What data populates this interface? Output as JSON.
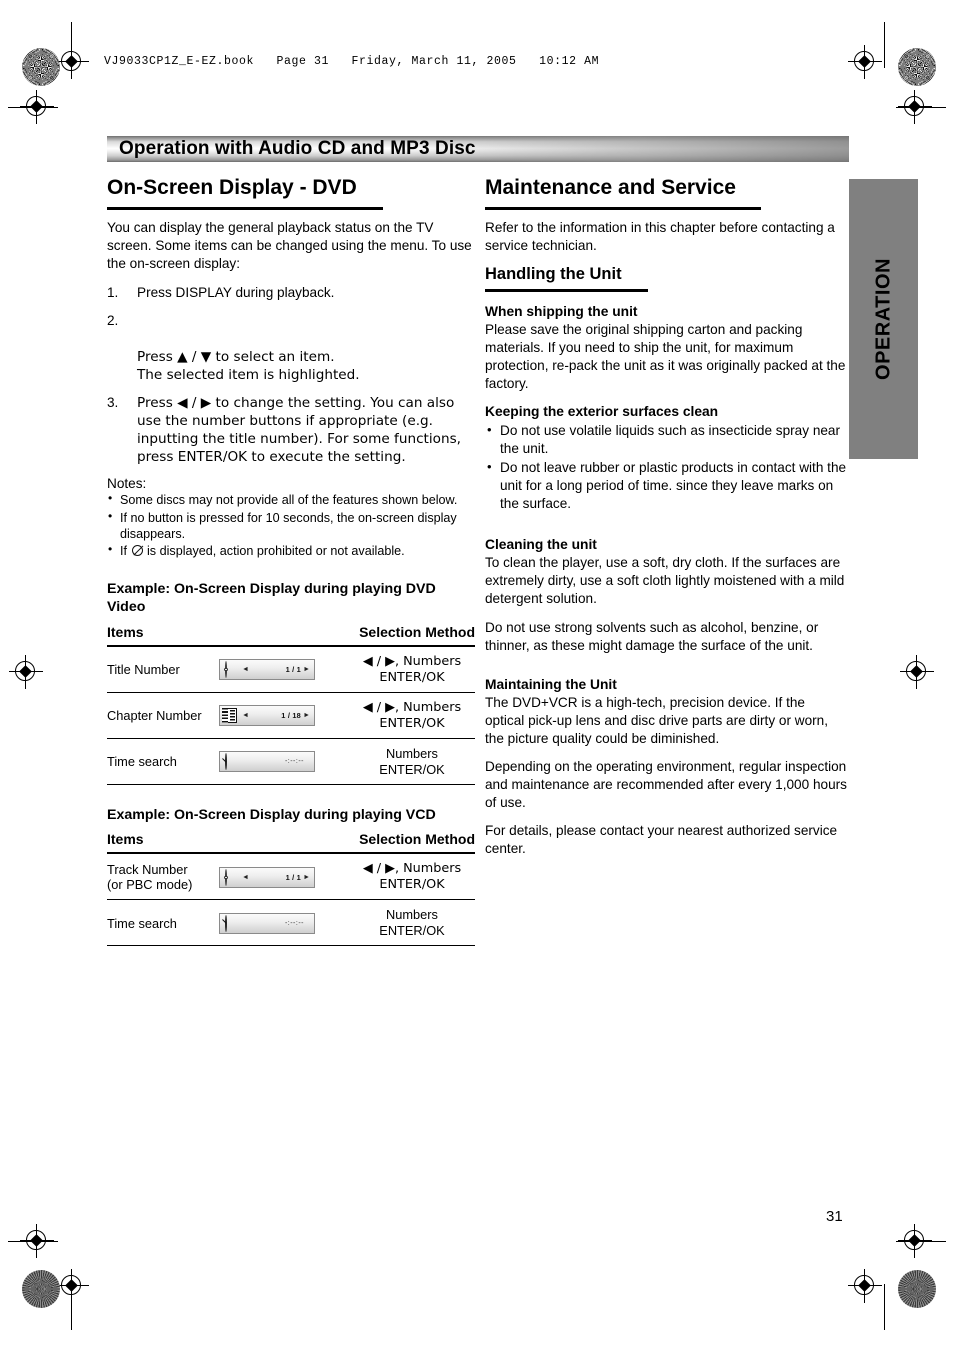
{
  "file_header": "VJ9033CP1Z_E-EZ.book   Page 31   Friday, March 11, 2005   10:12 AM",
  "chapter_bar": {
    "title": "Operation with Audio CD and MP3 Disc"
  },
  "side_tab": {
    "label": "OPERATION"
  },
  "page_number": "31",
  "left_column": {
    "heading": "On-Screen Display - DVD",
    "intro": "You can display the general playback status on the TV screen. Some items can be changed using the menu. To use the on-screen display:",
    "steps": [
      {
        "num": "1.",
        "text": "Press DISPLAY during playback."
      },
      {
        "num": "2.",
        "text": "Press ▲ / ▼ to select an item.\nThe selected item is highlighted."
      },
      {
        "num": "3.",
        "text": "Press ◀ / ▶ to change the setting. You can also use the number buttons if appropriate (e.g. inputting the title number). For some functions, press ENTER/OK to execute the setting."
      }
    ],
    "notes_title": "Notes:",
    "notes": [
      "Some discs may not provide all of the features shown below.",
      "If no button is pressed for 10 seconds, the on-screen display disappears.",
      "If   is displayed, action prohibited or not available."
    ],
    "note3_pre": "If",
    "note3_post": "is displayed, action prohibited or not available.",
    "example1_title": "Example: On-Screen Display during playing DVD Video",
    "table1": {
      "headers": {
        "items": "Items",
        "method": "Selection Method"
      },
      "rows": [
        {
          "item": "Title Number",
          "icon": "disc-icon",
          "osd_value": "1 / 1",
          "arrow_left": "◄",
          "arrow_right": "►",
          "method_line1": "◀ / ▶, Numbers",
          "method_line2": "ENTER/OK"
        },
        {
          "item": "Chapter Number",
          "icon": "film-icon",
          "osd_value": "1 / 18",
          "arrow_left": "◄",
          "arrow_right": "►",
          "method_line1": "◀ / ▶, Numbers",
          "method_line2": "ENTER/OK"
        },
        {
          "item": "Time search",
          "icon": "clock-icon",
          "osd_value": "-:--:--",
          "arrow_left": "",
          "arrow_right": "",
          "method_line1": "Numbers",
          "method_line2": "ENTER/OK"
        }
      ]
    },
    "example2_title": "Example: On-Screen Display during playing VCD",
    "table2": {
      "headers": {
        "items": "Items",
        "method": "Selection Method"
      },
      "rows": [
        {
          "item": "Track Number\n(or PBC mode)",
          "icon": "disc-icon",
          "osd_value": "1 / 1",
          "arrow_left": "◄",
          "arrow_right": "►",
          "method_line1": "◀ / ▶, Numbers",
          "method_line2": "ENTER/OK"
        },
        {
          "item": "Time search",
          "icon": "clock-icon",
          "osd_value": "-:--:--",
          "arrow_left": "",
          "arrow_right": "",
          "method_line1": "Numbers",
          "method_line2": "ENTER/OK"
        }
      ]
    }
  },
  "right_column": {
    "heading": "Maintenance and Service",
    "intro": "Refer to the information in this chapter before contacting a service technician.",
    "subsection": "Handling the Unit",
    "blocks": [
      {
        "subhead": "When shipping the unit",
        "paragraph": "Please save the original shipping carton and packing materials. If you need to ship the unit, for maximum protection, re-pack the unit as it was originally packed at the factory."
      },
      {
        "subhead": "Keeping the exterior surfaces clean",
        "bullets": [
          "Do not use volatile liquids such as insecticide spray near the unit.",
          "Do not leave rubber or plastic products in contact with the unit for a long period of time. since they leave marks on the surface."
        ]
      },
      {
        "subhead": "Cleaning the unit",
        "paragraph": "To clean the player, use a soft, dry cloth. If the surfaces are extremely dirty, use a soft cloth lightly moistened with a mild detergent solution.",
        "paragraph2": "Do not use strong solvents such as alcohol, benzine, or thinner, as these might damage the surface of the unit."
      },
      {
        "subhead": "Maintaining the Unit",
        "paragraph": "The DVD+VCR is a high-tech, precision device. If the optical pick-up lens and disc drive parts are dirty or worn, the picture quality could be diminished.",
        "paragraph2": "Depending on the operating environment, regular inspection and maintenance are recommended after every 1,000 hours of use.",
        "paragraph3": "For details, please contact your nearest authorized service center."
      }
    ]
  },
  "colors": {
    "side_tab_bg": "#808080",
    "text": "#000000",
    "page_bg": "#ffffff"
  }
}
